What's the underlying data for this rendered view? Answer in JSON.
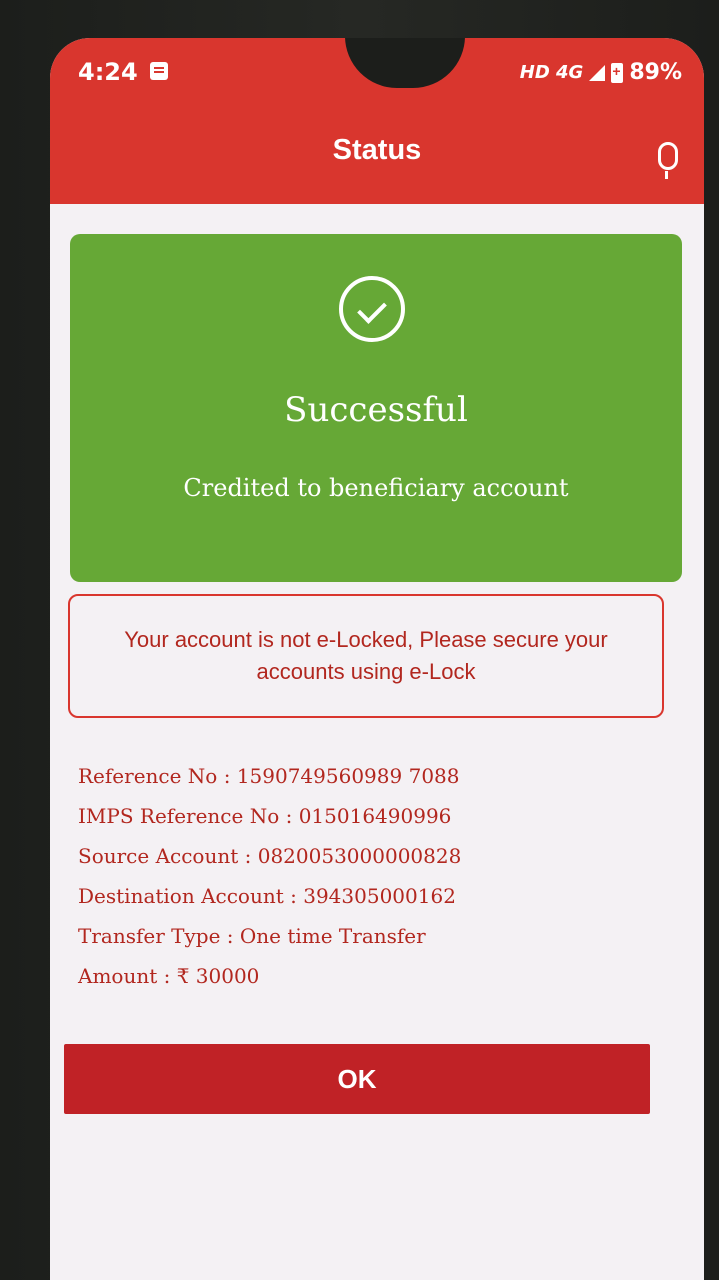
{
  "status_bar": {
    "time": "4:24",
    "network": "HD 4G",
    "battery": "89%"
  },
  "header": {
    "title": "Status"
  },
  "result": {
    "title": "Successful",
    "subtitle": "Credited to beneficiary account"
  },
  "warning": {
    "text": "Your account is not e-Locked, Please secure your accounts using e-Lock"
  },
  "details": [
    {
      "label": "Reference No",
      "value": "1590749560989 7088"
    },
    {
      "label": "IMPS Reference No",
      "value": "015016490996"
    },
    {
      "label": "Source Account",
      "value": "0820053000000828"
    },
    {
      "label": "Destination Account",
      "value": "394305000162"
    },
    {
      "label": "Transfer Type",
      "value": "One time Transfer"
    },
    {
      "label": "Amount",
      "value": "₹ 30000"
    }
  ],
  "actions": {
    "ok_label": "OK"
  },
  "colors": {
    "brand_red": "#d9362e",
    "success_green": "#66a836",
    "text_red": "#b2271f"
  }
}
